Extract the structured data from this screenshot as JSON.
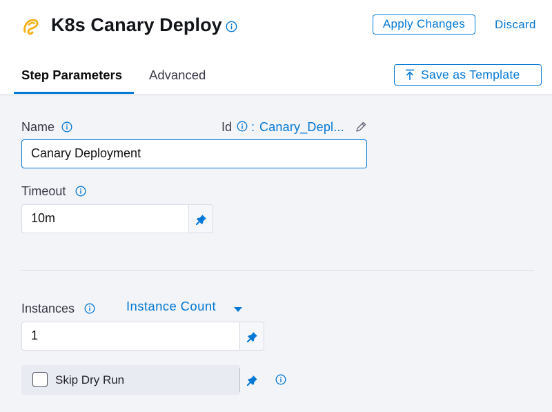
{
  "header": {
    "title": "K8s Canary Deploy",
    "apply_label": "Apply Changes",
    "discard_label": "Discard"
  },
  "tabs": {
    "items": [
      {
        "label": "Step Parameters",
        "active": true
      },
      {
        "label": "Advanced",
        "active": false
      }
    ],
    "save_template_label": "Save as Template"
  },
  "form": {
    "name_label": "Name",
    "name_value": "Canary Deployment",
    "id_label": "Id",
    "id_separator": ":",
    "id_value": "Canary_Depl...",
    "timeout_label": "Timeout",
    "timeout_value": "10m",
    "instances_label": "Instances",
    "instances_type": "Instance Count",
    "instances_value": "1",
    "skip_dry_run_label": "Skip Dry Run",
    "skip_dry_run_checked": false
  },
  "icons": {
    "logo": "harness-logo-icon",
    "info": "info-icon",
    "pin": "pin-icon",
    "edit": "pencil-icon",
    "upload": "upload-icon",
    "caret": "caret-down-icon"
  },
  "colors": {
    "accent": "#0278d5",
    "logo": "#f3b21b",
    "content_bg": "#f3f4f8"
  }
}
